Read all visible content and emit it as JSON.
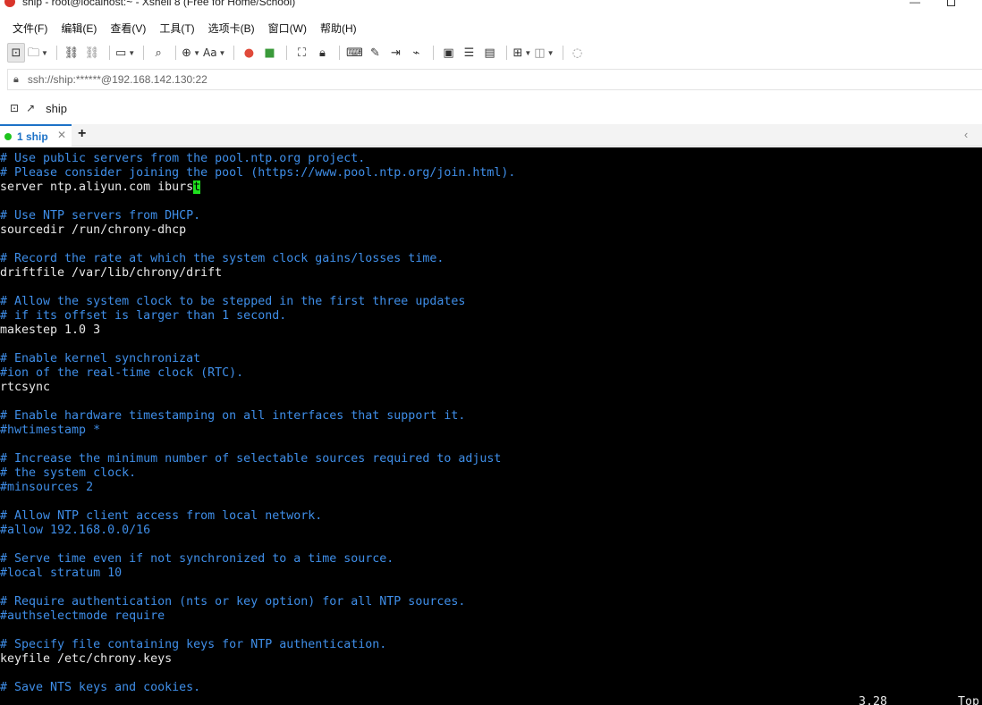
{
  "window": {
    "title": "ship - root@localhost:~ - Xshell 8 (Free for Home/School)",
    "minimize_glyph": "—"
  },
  "menu": [
    "文件(F)",
    "编辑(E)",
    "查看(V)",
    "工具(T)",
    "选项卡(B)",
    "窗口(W)",
    "帮助(H)"
  ],
  "toolbar": {
    "font_label": "Aa"
  },
  "address": {
    "url": "ssh://ship:******@192.168.142.130:22"
  },
  "session_bar": {
    "label": "ship"
  },
  "tabs": [
    {
      "label": "1 ship",
      "status": "connected"
    }
  ],
  "terminal": {
    "lines": [
      {
        "text": "# Use public servers from the pool.ntp.org project.",
        "kind": "comment"
      },
      {
        "text": "# Please consider joining the pool (https://www.pool.ntp.org/join.html).",
        "kind": "comment"
      },
      {
        "text": "server ntp.aliyun.com ibursT",
        "kind": "plain"
      },
      {
        "text": "",
        "kind": "plain"
      },
      {
        "text": "# Use NTP servers from DHCP.",
        "kind": "comment"
      },
      {
        "text": "sourcedir /run/chrony-dhcp",
        "kind": "plain"
      },
      {
        "text": "",
        "kind": "plain"
      },
      {
        "text": "# Record the rate at which the system clock gains/losses time.",
        "kind": "comment"
      },
      {
        "text": "driftfile /var/lib/chrony/drift",
        "kind": "plain"
      },
      {
        "text": "",
        "kind": "plain"
      },
      {
        "text": "# Allow the system clock to be stepped in the first three updates",
        "kind": "comment"
      },
      {
        "text": "# if its offset is larger than 1 second.",
        "kind": "comment"
      },
      {
        "text": "makestep 1.0 3",
        "kind": "plain"
      },
      {
        "text": "",
        "kind": "plain"
      },
      {
        "text": "# Enable kernel synchronizat",
        "kind": "comment"
      },
      {
        "text": "#ion of the real-time clock (RTC).",
        "kind": "comment"
      },
      {
        "text": "rtcsync",
        "kind": "plain"
      },
      {
        "text": "",
        "kind": "plain"
      },
      {
        "text": "# Enable hardware timestamping on all interfaces that support it.",
        "kind": "comment"
      },
      {
        "text": "#hwtimestamp *",
        "kind": "comment"
      },
      {
        "text": "",
        "kind": "plain"
      },
      {
        "text": "# Increase the minimum number of selectable sources required to adjust",
        "kind": "comment"
      },
      {
        "text": "# the system clock.",
        "kind": "comment"
      },
      {
        "text": "#minsources 2",
        "kind": "comment"
      },
      {
        "text": "",
        "kind": "plain"
      },
      {
        "text": "# Allow NTP client access from local network.",
        "kind": "comment"
      },
      {
        "text": "#allow 192.168.0.0/16",
        "kind": "comment"
      },
      {
        "text": "",
        "kind": "plain"
      },
      {
        "text": "# Serve time even if not synchronized to a time source.",
        "kind": "comment"
      },
      {
        "text": "#local stratum 10",
        "kind": "comment"
      },
      {
        "text": "",
        "kind": "plain"
      },
      {
        "text": "# Require authentication (nts or key option) for all NTP sources.",
        "kind": "comment"
      },
      {
        "text": "#authselectmode require",
        "kind": "comment"
      },
      {
        "text": "",
        "kind": "plain"
      },
      {
        "text": "# Specify file containing keys for NTP authentication.",
        "kind": "comment"
      },
      {
        "text": "keyfile /etc/chrony.keys",
        "kind": "plain"
      },
      {
        "text": "",
        "kind": "plain"
      },
      {
        "text": "# Save NTS keys and cookies.",
        "kind": "comment"
      }
    ],
    "cursor": {
      "line": 2,
      "col": 27,
      "char": "t"
    },
    "status_position": "3,28",
    "status_scroll": "Top"
  }
}
